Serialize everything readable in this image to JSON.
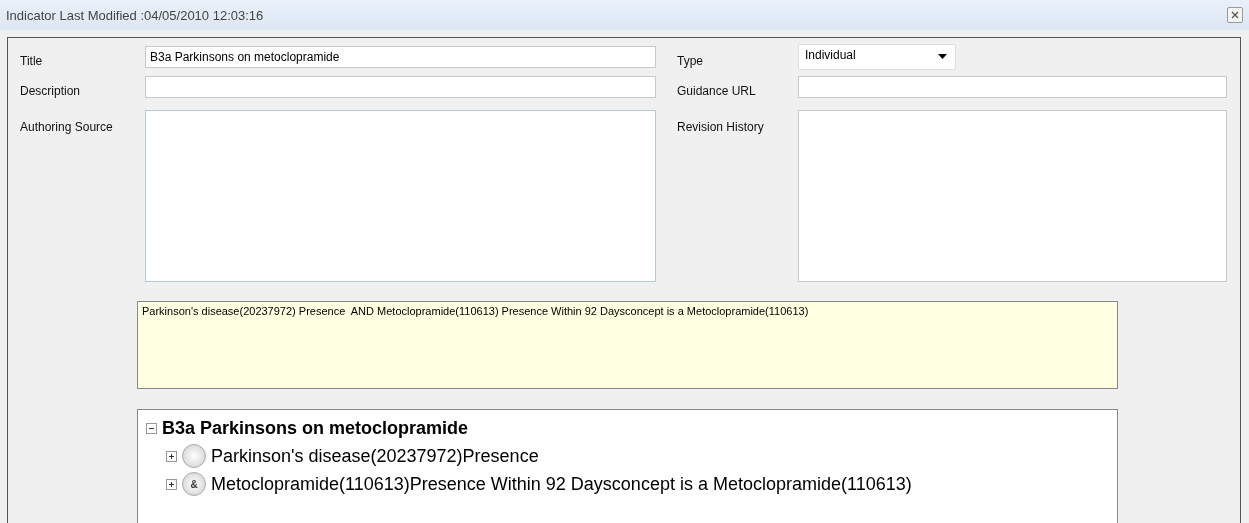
{
  "window": {
    "title": "Indicator Last Modified :04/05/2010 12:03:16"
  },
  "form": {
    "title": {
      "label": "Title",
      "value": "B3a Parkinsons on metoclopramide"
    },
    "description": {
      "label": "Description"
    },
    "authoring_source": {
      "label": "Authoring Source"
    },
    "type": {
      "label": "Type",
      "value": "Individual"
    },
    "guidance_url": {
      "label": "Guidance URL"
    },
    "revision_history": {
      "label": "Revision History"
    }
  },
  "expression": "Parkinson's disease(20237972) Presence  AND Metoclopramide(110613) Presence Within 92 Daysconcept is a Metoclopramide(110613)",
  "tree": {
    "label": "B3a Parkinsons on metoclopramide",
    "expanded": true,
    "children": [
      {
        "label": "Parkinson's disease(20237972)Presence",
        "expanded": false
      },
      {
        "label": "Metoclopramide(110613)Presence Within 92 Daysconcept is a Metoclopramide(110613)",
        "expanded": false,
        "badge": "&"
      }
    ]
  }
}
